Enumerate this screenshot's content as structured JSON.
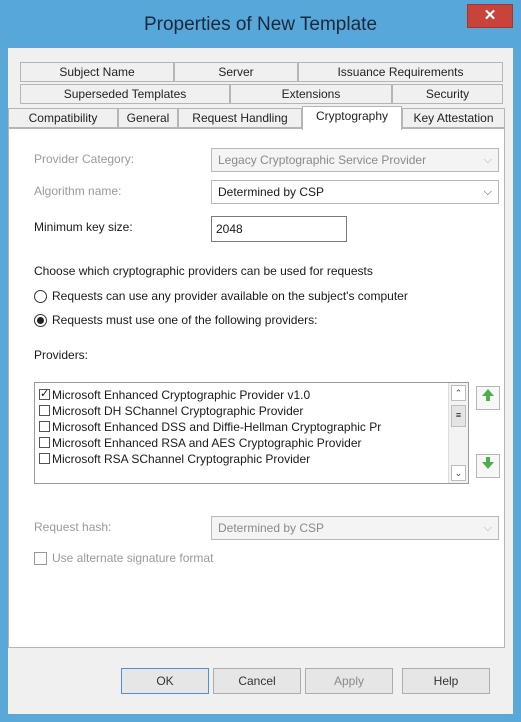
{
  "window": {
    "title": "Properties of New Template"
  },
  "tabs_row1": [
    "Subject Name",
    "Server",
    "Issuance Requirements"
  ],
  "tabs_row2": [
    "Superseded Templates",
    "Extensions",
    "Security"
  ],
  "tabs_row3": [
    "Compatibility",
    "General",
    "Request Handling",
    "Cryptography",
    "Key Attestation"
  ],
  "active_tab": "Cryptography",
  "provider_category": {
    "label": "Provider Category:",
    "value": "Legacy Cryptographic Service Provider"
  },
  "algorithm_name": {
    "label": "Algorithm name:",
    "value": "Determined by CSP"
  },
  "min_key_size": {
    "label": "Minimum key size:",
    "value": "2048"
  },
  "choose_text": "Choose which cryptographic providers can be used for requests",
  "radio_any": "Requests can use any provider available on the subject's computer",
  "radio_must": "Requests must use one of the following providers:",
  "providers_label": "Providers:",
  "providers": [
    {
      "name": "Microsoft Enhanced Cryptographic Provider v1.0",
      "checked": true
    },
    {
      "name": "Microsoft DH SChannel Cryptographic Provider",
      "checked": false
    },
    {
      "name": "Microsoft Enhanced DSS and Diffie-Hellman Cryptographic Pr",
      "checked": false
    },
    {
      "name": "Microsoft Enhanced RSA and AES Cryptographic Provider",
      "checked": false
    },
    {
      "name": "Microsoft RSA SChannel Cryptographic Provider",
      "checked": false
    }
  ],
  "request_hash": {
    "label": "Request hash:",
    "value": "Determined by CSP"
  },
  "alt_signature": "Use alternate signature format",
  "buttons": {
    "ok": "OK",
    "cancel": "Cancel",
    "apply": "Apply",
    "help": "Help"
  },
  "colors": {
    "titlebar": "#57a7da",
    "close": "#c8433a",
    "arrow_green": "#4caf50"
  }
}
